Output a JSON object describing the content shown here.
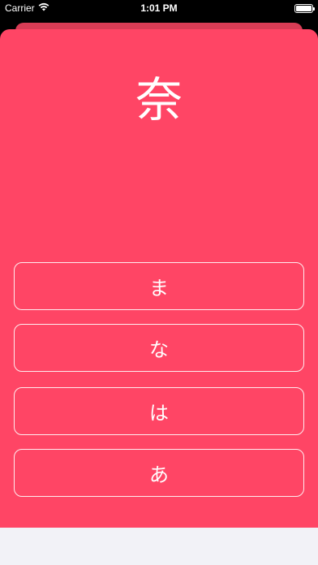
{
  "status_bar": {
    "carrier": "Carrier",
    "time": "1:01 PM",
    "icons": [
      "wifi-icon",
      "battery-icon"
    ]
  },
  "quiz": {
    "kanji": "奈",
    "answers": [
      "ま",
      "な",
      "は",
      "あ"
    ]
  },
  "colors": {
    "card": "#ff4565",
    "card_back": "#d83c55",
    "bottom": "#f2f2f7"
  }
}
